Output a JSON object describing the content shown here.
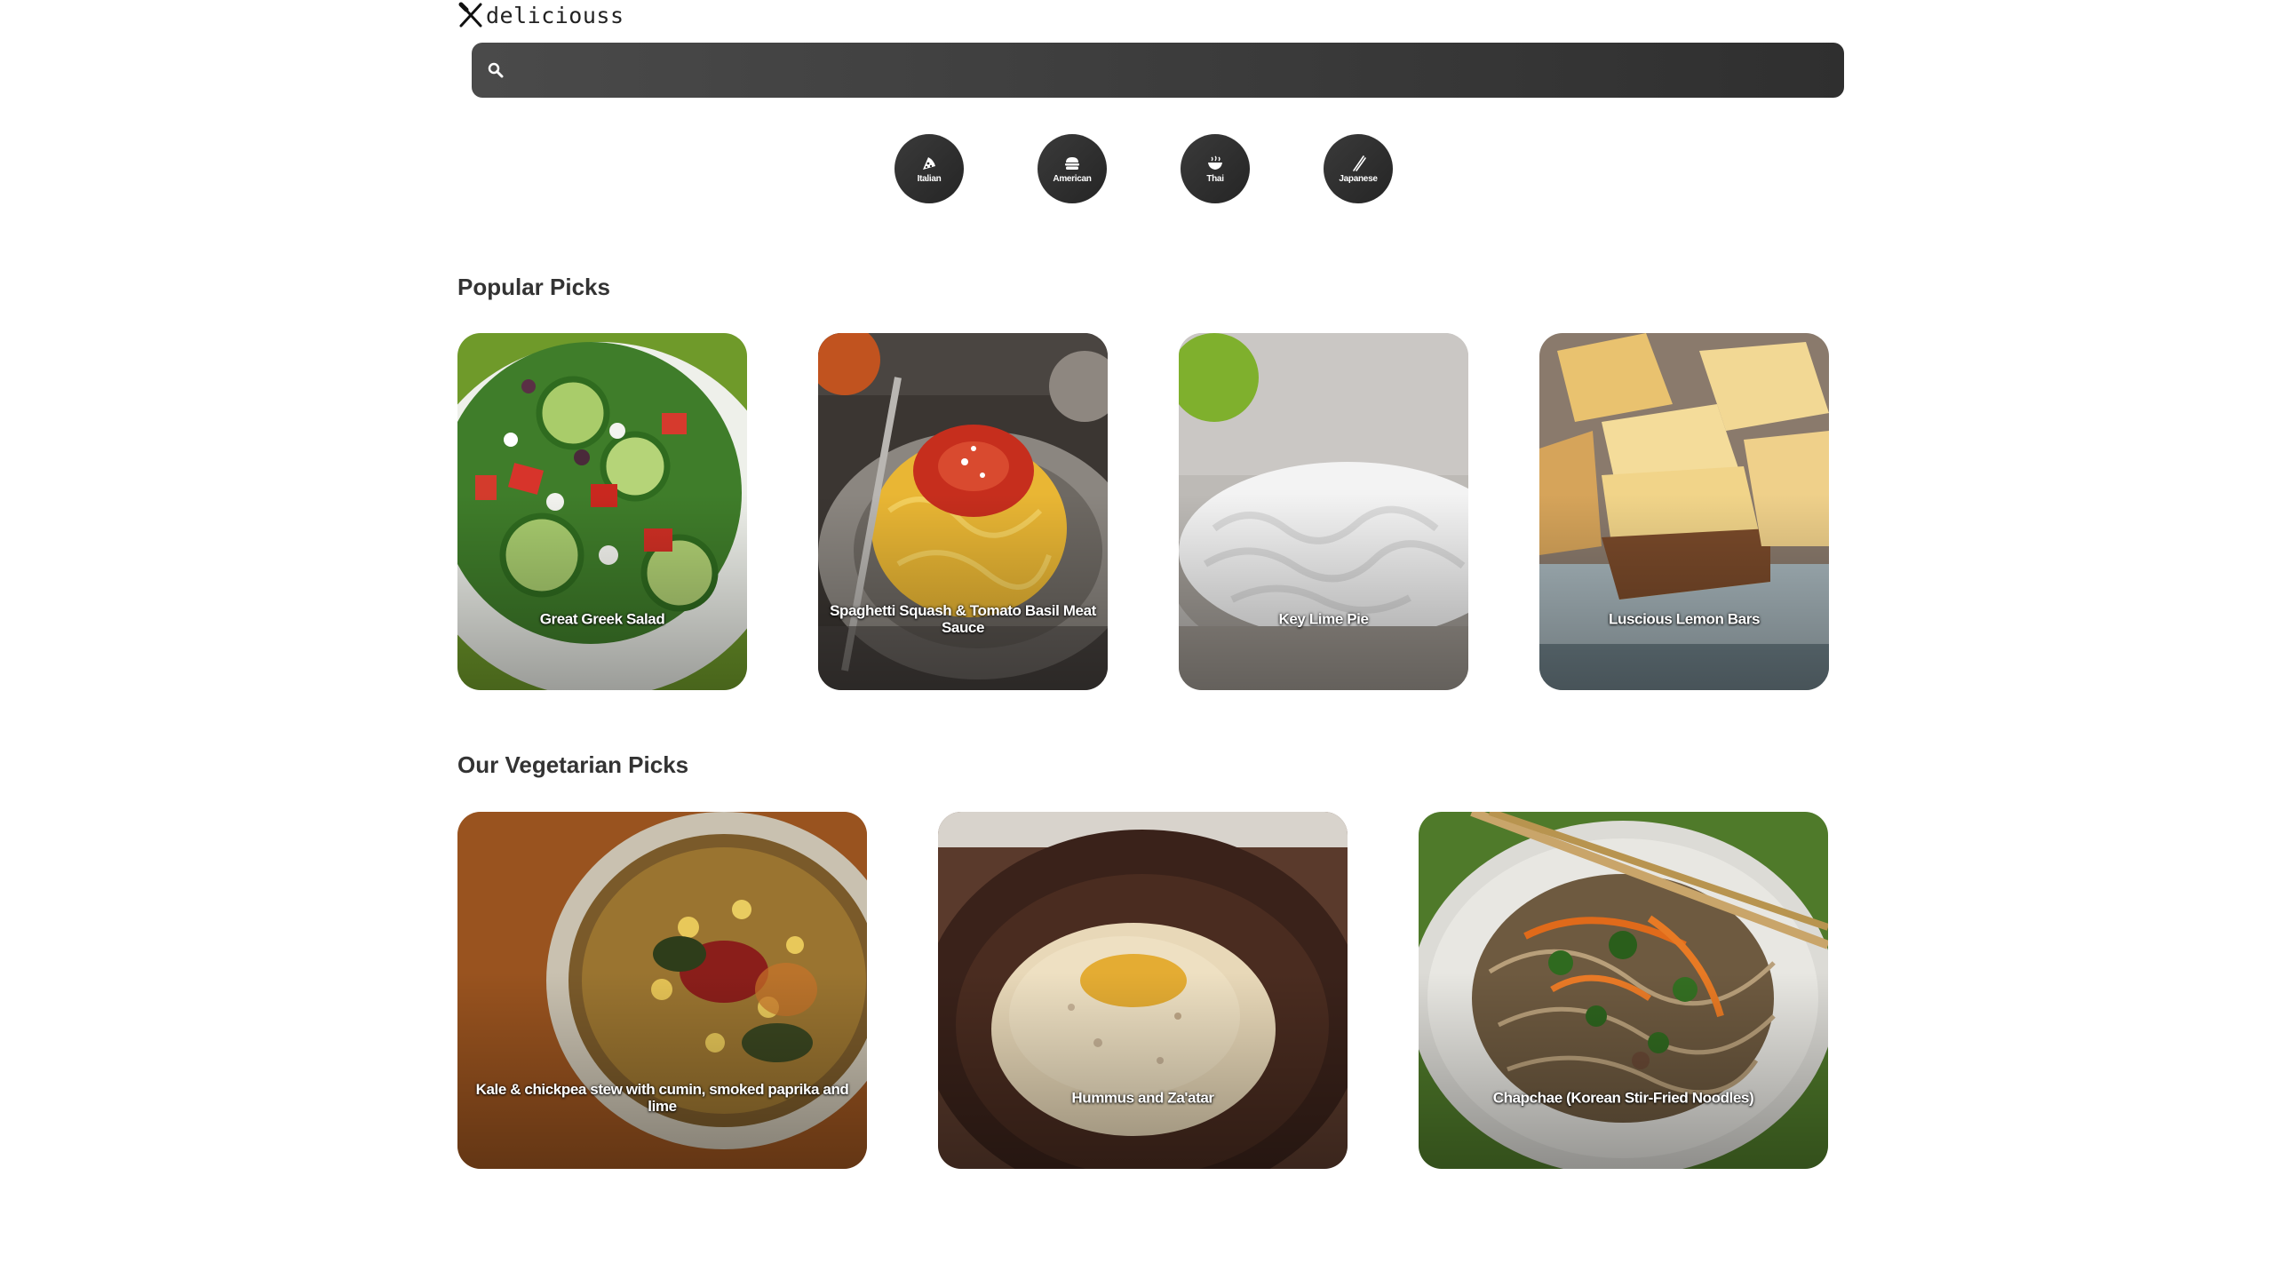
{
  "logo": {
    "text": "deliciouss"
  },
  "search": {
    "value": "",
    "placeholder": ""
  },
  "cuisines": [
    {
      "label": "Italian",
      "icon": "pizza-icon"
    },
    {
      "label": "American",
      "icon": "burger-icon"
    },
    {
      "label": "Thai",
      "icon": "noodle-bowl-icon"
    },
    {
      "label": "Japanese",
      "icon": "chopsticks-icon"
    }
  ],
  "sections": {
    "popular": {
      "title": "Popular Picks",
      "items": [
        {
          "label": "Great Greek Salad"
        },
        {
          "label": "Spaghetti Squash & Tomato Basil Meat Sauce"
        },
        {
          "label": "Key Lime Pie"
        },
        {
          "label": "Luscious Lemon Bars"
        }
      ]
    },
    "vegetarian": {
      "title": "Our Vegetarian Picks",
      "items": [
        {
          "label": "Kale & chickpea stew with cumin, smoked paprika and lime"
        },
        {
          "label": "Hummus and Za'atar"
        },
        {
          "label": "Chapchae (Korean Stir-Fried Noodles)"
        }
      ]
    }
  },
  "colors": {
    "search_bg": "#3a3a3a",
    "cuisine_bg": "#2b2b2b",
    "text": "#333333"
  }
}
